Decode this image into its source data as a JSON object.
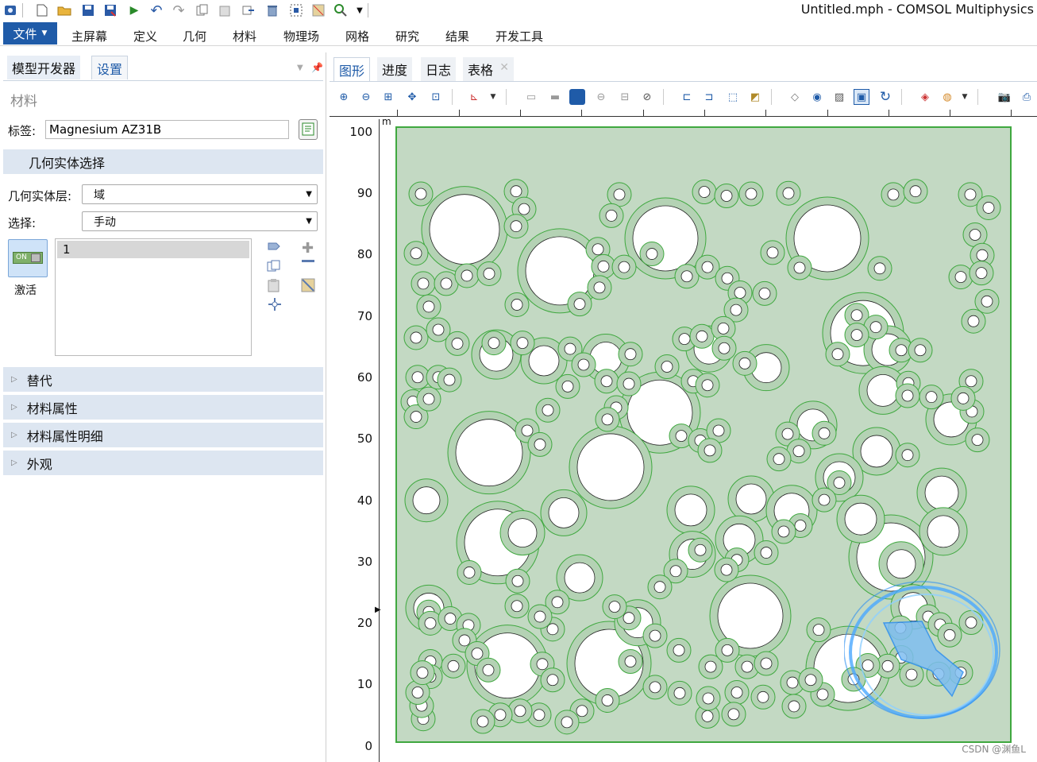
{
  "window": {
    "title": "Untitled.mph - COMSOL Multiphysics"
  },
  "ribbon": {
    "file": "文件",
    "tabs": [
      "主屏幕",
      "定义",
      "几何",
      "材料",
      "物理场",
      "网格",
      "研究",
      "结果",
      "开发工具"
    ]
  },
  "left_panel": {
    "tabs": [
      "模型开发器",
      "设置"
    ],
    "section_title": "材料",
    "label_caption": "标签:",
    "label_value": "Magnesium AZ31B",
    "geom_section": "几何实体选择",
    "geom_level_label": "几何实体层:",
    "geom_level_value": "域",
    "selection_label": "选择:",
    "selection_value": "手动",
    "toggle_text": "ON",
    "active_label": "激活",
    "selection_items": [
      "1"
    ],
    "collapsed_sections": [
      "替代",
      "材料属性",
      "材料属性明细",
      "外观"
    ]
  },
  "graphics": {
    "tabs": [
      "图形",
      "进度",
      "日志",
      "表格"
    ],
    "unit_label": "m",
    "y_ticks": [
      "100",
      "90",
      "80",
      "70",
      "60",
      "50",
      "40",
      "30",
      "20",
      "10",
      "0"
    ],
    "colors": {
      "domain_fill": "#c3d9c3",
      "circle_edge": "#3fa83f",
      "hole_fill": "#ffffff",
      "accent": "#1f5ba8"
    }
  },
  "watermark": "CSDN @渊鱼L"
}
